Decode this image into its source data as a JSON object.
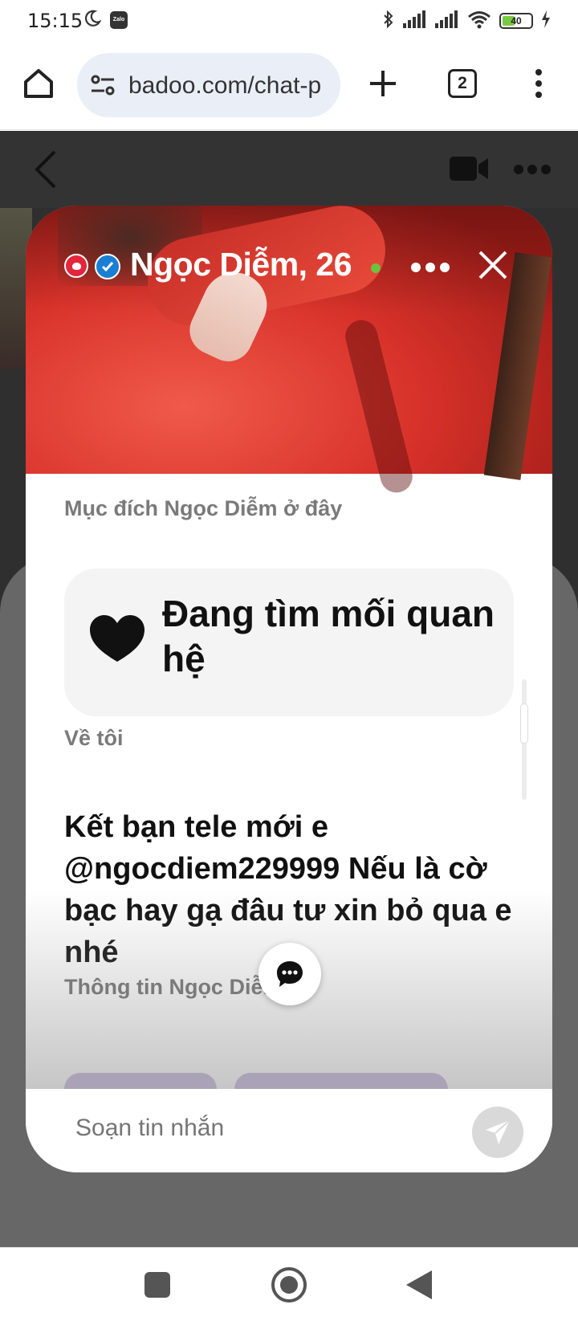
{
  "status_bar": {
    "time": "15:15",
    "zalo_label": "Zalo",
    "battery": "40"
  },
  "browser": {
    "url": "badoo.com/chat-p",
    "tab_count": "2"
  },
  "profile": {
    "name": "Ngọc Diễm, 26",
    "online_color": "#6ec03f"
  },
  "purpose": {
    "label": "Mục đích Ngọc Diễm ở đây",
    "value": "Đang tìm mối quan hệ"
  },
  "about": {
    "label": "Về tôi",
    "text": "Kết bạn tele mới e @ngocdiem229999 Nếu là cờ bạc hay gạ đâu tư xin bỏ qua e nhé"
  },
  "info": {
    "label": "Thông tin Ngọc Diễm"
  },
  "composer": {
    "placeholder": "Soạn tin nhắn"
  },
  "colors": {
    "verified_blue": "#1a7fd4",
    "badge_red": "#e3263b",
    "photo_red": "#d8322a"
  }
}
